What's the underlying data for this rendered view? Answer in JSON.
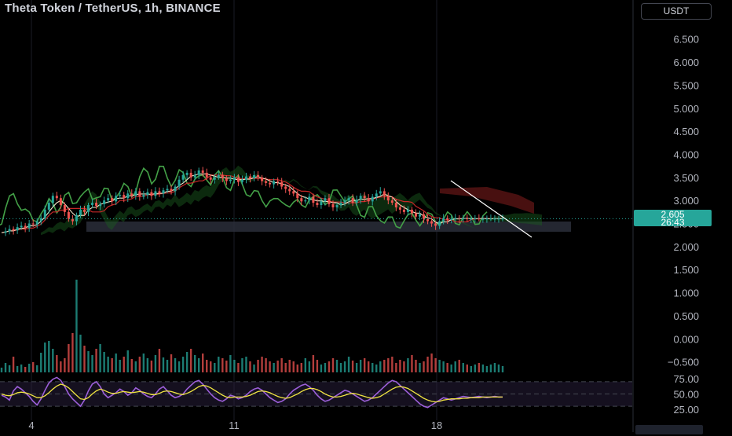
{
  "title": "Theta Token / TetherUS, 1h, BINANCE",
  "currency": "USDT",
  "last_price": "2.605",
  "countdown": "26:43",
  "colors": {
    "background": "#000000",
    "up": "#26a69a",
    "down": "#ef5350",
    "rsi": "#9c5fd9",
    "rsi_ma": "#f0e442",
    "lagging_span": "#43a047",
    "kumo_bull": "#1b5e20",
    "kumo_bear": "#5a1414"
  },
  "chart_data": [
    {
      "type": "line",
      "title": "Theta Token / TetherUS, 1h, BINANCE",
      "y_axis": {
        "ticks": [
          "6.500",
          "6.000",
          "5.500",
          "5.000",
          "4.500",
          "4.000",
          "3.500",
          "3.000",
          "2.500",
          "2.000",
          "1.500",
          "1.000",
          "0.500",
          "0.000",
          "−0.500"
        ],
        "ylim": [
          -0.5,
          6.5
        ]
      },
      "x_axis": {
        "ticks": [
          "4",
          "11",
          "18"
        ]
      },
      "series": [
        {
          "name": "",
          "x": [
            0,
            1,
            2,
            3,
            4,
            5,
            6,
            7,
            8,
            9,
            10,
            11,
            12,
            13,
            14,
            15,
            16,
            17,
            18,
            19,
            20,
            21,
            22,
            23,
            24,
            25,
            26,
            27,
            28,
            29,
            30,
            31,
            32,
            33,
            34,
            35,
            36,
            37,
            38,
            39,
            40,
            41,
            42,
            43,
            44,
            45,
            46,
            47,
            48,
            49,
            50,
            51,
            52,
            53,
            54,
            55,
            56,
            57,
            58,
            59,
            60,
            61,
            62,
            63,
            64,
            65,
            66,
            67,
            68,
            69,
            70,
            71,
            72,
            73,
            74,
            75,
            76,
            77,
            78,
            79,
            80,
            81,
            82,
            83,
            84,
            85,
            86,
            87,
            88,
            89,
            90,
            91,
            92,
            93,
            94,
            95,
            96,
            97,
            98,
            99,
            100,
            101,
            102,
            103,
            104,
            105,
            106,
            107,
            108,
            109,
            110,
            111,
            112,
            113,
            114,
            115,
            116,
            117,
            118,
            119,
            120,
            121,
            122,
            123,
            124,
            125,
            126,
            127
          ],
          "values": [
            2.3,
            2.33,
            2.38,
            2.35,
            2.42,
            2.45,
            2.4,
            2.5,
            2.48,
            2.55,
            2.62,
            2.8,
            2.95,
            3.1,
            3.05,
            2.9,
            2.75,
            2.6,
            2.55,
            2.68,
            2.8,
            2.75,
            2.9,
            2.95,
            2.88,
            2.92,
            3.0,
            3.05,
            2.98,
            3.1,
            3.12,
            3.05,
            3.15,
            3.1,
            3.2,
            3.08,
            3.12,
            3.18,
            3.1,
            3.2,
            3.15,
            3.22,
            3.25,
            3.2,
            3.3,
            3.45,
            3.55,
            3.6,
            3.5,
            3.55,
            3.65,
            3.6,
            3.5,
            3.45,
            3.5,
            3.55,
            3.48,
            3.42,
            3.45,
            3.5,
            3.4,
            3.45,
            3.52,
            3.48,
            3.55,
            3.5,
            3.42,
            3.38,
            3.35,
            3.42,
            3.4,
            3.3,
            3.25,
            3.2,
            3.15,
            3.05,
            2.98,
            3.0,
            3.08,
            2.95,
            2.9,
            2.98,
            3.05,
            2.92,
            2.85,
            2.9,
            2.95,
            3.0,
            3.05,
            2.95,
            3.02,
            3.1,
            3.05,
            2.98,
            3.08,
            3.15,
            3.2,
            3.1,
            3.0,
            2.95,
            2.85,
            2.8,
            2.75,
            2.8,
            2.72,
            2.65,
            2.7,
            2.6,
            2.55,
            2.5,
            2.45,
            2.55,
            2.62,
            2.58,
            2.6,
            2.62,
            2.6,
            2.61,
            2.6,
            2.6,
            2.61,
            2.6,
            2.6,
            2.605,
            2.605,
            2.605,
            2.605,
            2.605
          ]
        }
      ],
      "volume": [
        6,
        12,
        9,
        20,
        8,
        10,
        7,
        11,
        13,
        9,
        25,
        38,
        40,
        30,
        22,
        14,
        18,
        36,
        50,
        118,
        48,
        34,
        27,
        22,
        30,
        36,
        26,
        20,
        18,
        24,
        16,
        20,
        28,
        17,
        14,
        20,
        24,
        18,
        15,
        22,
        30,
        19,
        16,
        23,
        18,
        14,
        20,
        26,
        30,
        22,
        18,
        24,
        16,
        14,
        12,
        20,
        18,
        15,
        22,
        16,
        12,
        18,
        20,
        14,
        10,
        16,
        20,
        18,
        14,
        12,
        15,
        18,
        12,
        16,
        14,
        10,
        12,
        18,
        14,
        22,
        16,
        10,
        12,
        14,
        18,
        16,
        12,
        14,
        20,
        15,
        12,
        16,
        18,
        14,
        12,
        10,
        14,
        16,
        18,
        20,
        12,
        16,
        14,
        18,
        22,
        16,
        12,
        14,
        20,
        24,
        18,
        16,
        14,
        12,
        10,
        14,
        16,
        12,
        10,
        8,
        10,
        12,
        10,
        8,
        10,
        12,
        10,
        8
      ]
    },
    {
      "type": "line",
      "title": "",
      "y_axis": {
        "ticks": [
          "75.00",
          "50.00",
          "25.00"
        ],
        "ylim": [
          25,
          80
        ]
      },
      "series": [
        {
          "name": "",
          "values": [
            48,
            45,
            40,
            55,
            62,
            58,
            52,
            46,
            38,
            32,
            42,
            56,
            68,
            74,
            77,
            72,
            62,
            50,
            42,
            36,
            30,
            40,
            55,
            66,
            70,
            62,
            50,
            44,
            48,
            52,
            58,
            54,
            48,
            52,
            60,
            56,
            50,
            46,
            44,
            50,
            58,
            62,
            55,
            48,
            44,
            46,
            50,
            58,
            64,
            70,
            72,
            66,
            58,
            50,
            44,
            40,
            38,
            42,
            48,
            46,
            42,
            44,
            48,
            54,
            58,
            60,
            56,
            50,
            44,
            40,
            36,
            38,
            42,
            50,
            56,
            60,
            64,
            66,
            62,
            56,
            48,
            42,
            38,
            40,
            44,
            48,
            52,
            56,
            54,
            50,
            46,
            42,
            38,
            40,
            44,
            50,
            56,
            62,
            68,
            72,
            70,
            64,
            58,
            52,
            46,
            40,
            34,
            30,
            28,
            32,
            36,
            40,
            44,
            42,
            40,
            42,
            44,
            46,
            45,
            44,
            45,
            46,
            45,
            44,
            45,
            46,
            45,
            45
          ]
        },
        {
          "name": "",
          "values": [
            50,
            48,
            47,
            49,
            52,
            53,
            52,
            50,
            47,
            44,
            44,
            47,
            52,
            58,
            63,
            66,
            64,
            60,
            54,
            48,
            42,
            41,
            44,
            50,
            55,
            58,
            56,
            53,
            51,
            51,
            53,
            54,
            53,
            52,
            53,
            54,
            53,
            51,
            49,
            49,
            51,
            54,
            55,
            54,
            52,
            50,
            49,
            51,
            54,
            58,
            62,
            64,
            63,
            60,
            56,
            52,
            48,
            45,
            44,
            45,
            45,
            45,
            46,
            48,
            51,
            54,
            55,
            54,
            52,
            49,
            46,
            44,
            43,
            44,
            47,
            50,
            54,
            57,
            59,
            59,
            57,
            54,
            50,
            47,
            45,
            45,
            46,
            48,
            50,
            51,
            50,
            48,
            46,
            44,
            43,
            44,
            46,
            50,
            54,
            58,
            61,
            62,
            61,
            59,
            55,
            51,
            47,
            43,
            40,
            38,
            37,
            38,
            40,
            41,
            42,
            42,
            42,
            43,
            43,
            44,
            44,
            44,
            45,
            45,
            45,
            45,
            45,
            45
          ]
        }
      ]
    }
  ]
}
